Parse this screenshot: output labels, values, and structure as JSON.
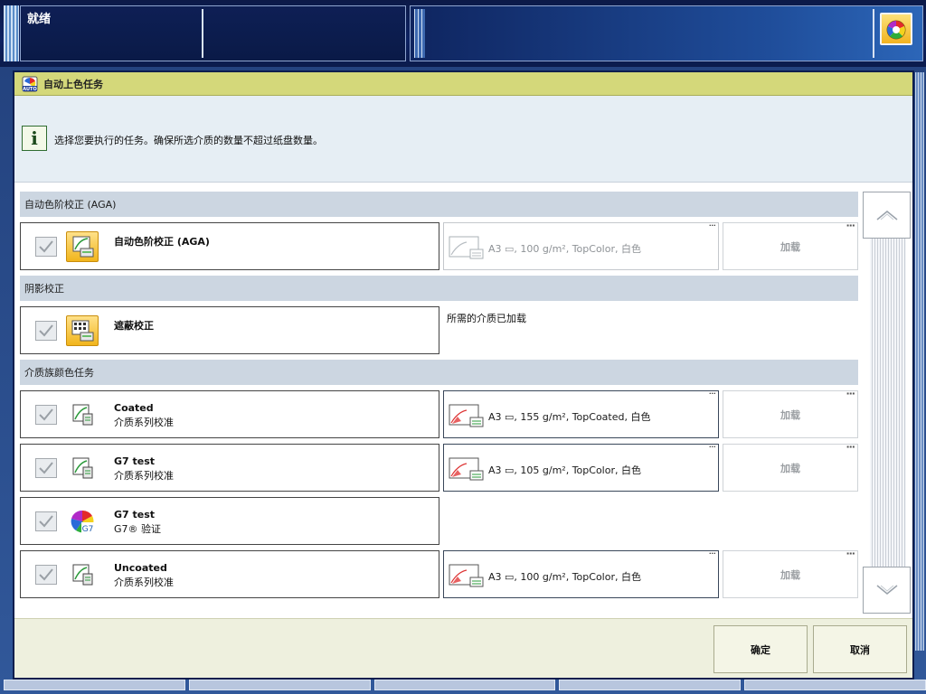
{
  "topbar": {
    "status": "就绪"
  },
  "dialog": {
    "title": "自动上色任务",
    "info_text": "选择您要执行的任务。确保所选介质的数量不超过纸盘数量。",
    "sections": [
      {
        "label": "自动色阶校正 (AGA)"
      },
      {
        "label": "阴影校正"
      },
      {
        "label": "介质族颜色任务"
      }
    ],
    "tasks": [
      {
        "name": "自动色阶校正 (AGA)",
        "subtitle": "",
        "checked": true,
        "icon": "printer-calibration-icon",
        "media": "A3 ▭, 100 g/m², TopColor, 白色",
        "media_enabled": false,
        "load_label": "加载"
      },
      {
        "name": "遮蔽校正",
        "subtitle": "",
        "checked": true,
        "icon": "grid-printer-icon",
        "note": "所需的介质已加载"
      },
      {
        "name": "Coated",
        "subtitle": "介质系列校准",
        "checked": true,
        "icon": "media-calibration-icon",
        "media": "A3 ▭, 155 g/m², TopCoated, 白色",
        "media_enabled": true,
        "load_label": "加载"
      },
      {
        "name": "G7 test",
        "subtitle": "介质系列校准",
        "checked": true,
        "icon": "media-calibration-icon",
        "media": "A3 ▭, 105 g/m², TopColor, 白色",
        "media_enabled": true,
        "load_label": "加载"
      },
      {
        "name": "G7 test",
        "subtitle": "G7® 验证",
        "checked": true,
        "icon": "g7-color-wheel-icon"
      },
      {
        "name": "Uncoated",
        "subtitle": "介质系列校准",
        "checked": true,
        "icon": "media-calibration-icon",
        "media": "A3 ▭, 100 g/m², TopColor, 白色",
        "media_enabled": true,
        "load_label": "加载"
      }
    ],
    "more_label": "···",
    "ok_label": "确定",
    "cancel_label": "取消"
  },
  "colors": {
    "title_bar": "#d4d87a",
    "section_header": "#ccd6e1",
    "info_bg": "#e6eef4",
    "footer_bg": "#eef0de",
    "topbar": "#0c1a48"
  }
}
